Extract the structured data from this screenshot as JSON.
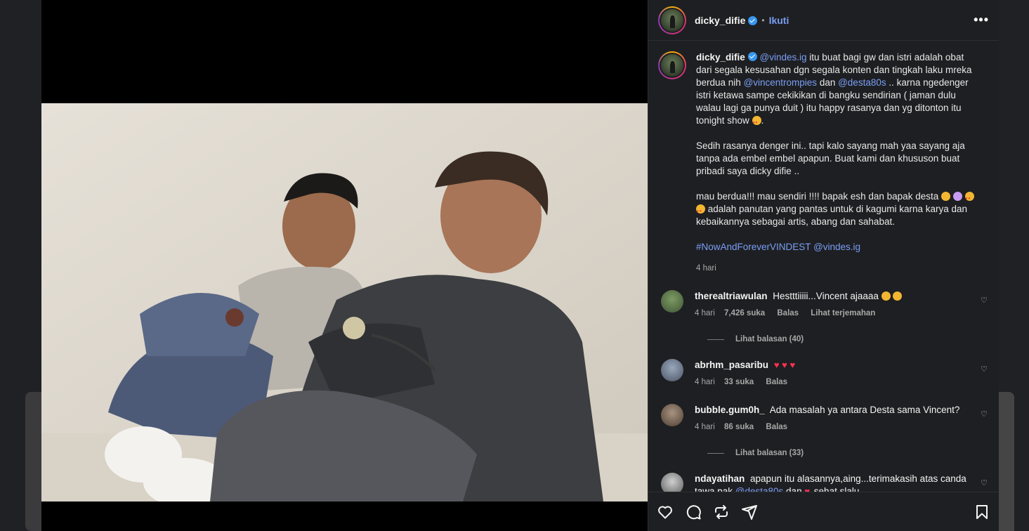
{
  "post": {
    "username": "dicky_difie",
    "follow_label": "Ikuti",
    "separator": "•",
    "more_label": "•••"
  },
  "caption": {
    "username": "dicky_difie",
    "p1_m1": "@vindes.ig",
    "p1_t1": " itu buat bagi gw dan istri adalah obat dari segala kesusahan dgn segala konten dan tingkah laku mreka berdua nih ",
    "p1_m2": "@vincentrompies",
    "p1_t2": " dan ",
    "p1_m3": "@desta80s",
    "p1_t3": " .. karna ngedenger istri ketawa sampe cekikikan di bangku sendirian ( jaman dulu walau lagi ga punya duit ) itu happy rasanya dan yg ditonton itu tonight show ",
    "p1_end": ".",
    "p2": "Sedih rasanya denger ini.. tapi kalo sayang mah yaa sayang aja tanpa ada embel embel apapun. Buat kami dan khususon buat pribadi saya dicky difie ..",
    "p3_a": "mau berdua!!! mau sendiri !!!! bapak esh dan bapak desta ",
    "p3_b": " adalah panutan yang pantas untuk di kagumi karna karya dan kebaikannya sebagai artis, abang dan sahabat.",
    "hashtag": "#NowAndForeverVINDEST",
    "tag_end": " @vindes.ig",
    "time": "4 hari"
  },
  "comments": [
    {
      "username": "therealtriawulan",
      "text": "Hestttiiiii...Vincent ajaaaa",
      "time": "4 hari",
      "likes": "7,426 suka",
      "reply": "Balas",
      "translate": "Lihat terjemahan",
      "view_replies": "Lihat balasan (40)",
      "avatar_color": "#6f8a5a"
    },
    {
      "username": "abrhm_pasaribu",
      "text": "",
      "hearts": "♥ ♥ ♥",
      "time": "4 hari",
      "likes": "33 suka",
      "reply": "Balas",
      "avatar_color": "#7c8aa0"
    },
    {
      "username": "bubble.gum0h_",
      "text": "Ada masalah ya antara Desta sama Vincent?",
      "time": "4 hari",
      "likes": "86 suka",
      "reply": "Balas",
      "view_replies": "Lihat balasan (33)",
      "avatar_color": "#8d7b6a"
    },
    {
      "username": "ndayatihan",
      "text": "apapun itu alasannya,aing...terimakasih atas canda tawa pak ",
      "mention": "@desta80s",
      "text2": " dan ",
      "text3": " sehat slalu",
      "avatar_color": "#9a9a9a"
    }
  ],
  "icons": [
    "heart-icon",
    "comment-icon",
    "share-icon",
    "send-icon",
    "save-icon",
    "verified-icon",
    "more-icon"
  ],
  "colors": {
    "panel_bg": "#1e1f22",
    "link": "#7a9ef5",
    "media_bg": "#000000"
  }
}
